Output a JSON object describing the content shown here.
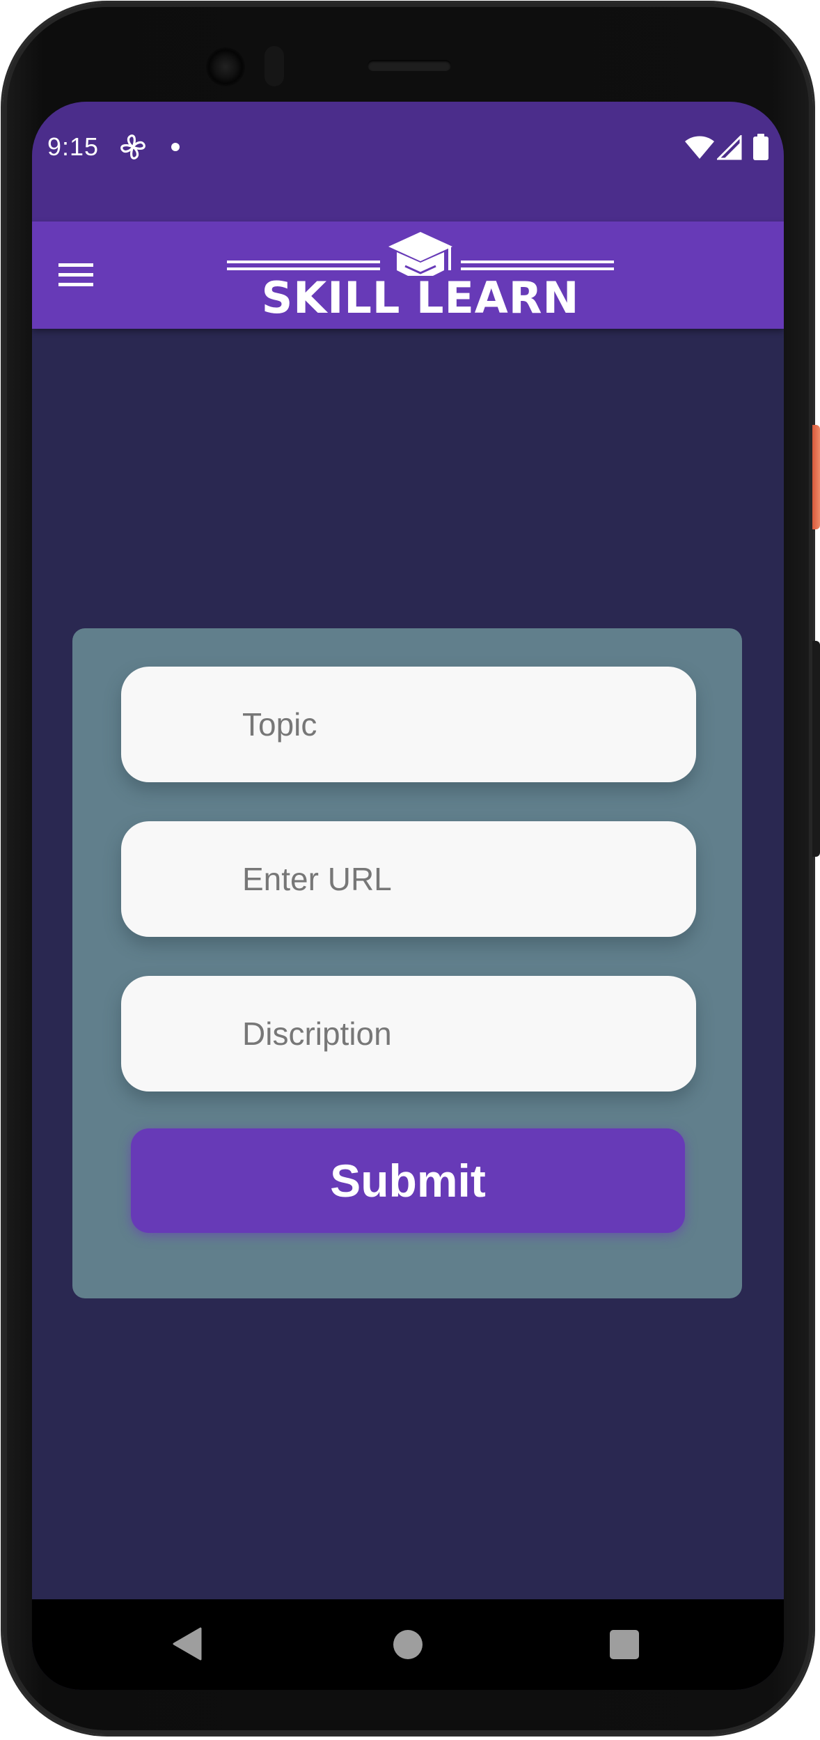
{
  "status_bar": {
    "time": "9:15",
    "icons": [
      "fan-icon",
      "notification-dot-icon",
      "wifi-icon",
      "cellular-signal-icon",
      "battery-icon"
    ]
  },
  "app_bar": {
    "menu_icon": "hamburger-menu-icon",
    "logo_text": "SKILL LEARN",
    "logo_icon": "graduation-cap-icon",
    "color": "#673ab7"
  },
  "form": {
    "topic_placeholder": "Topic",
    "url_placeholder": "Enter URL",
    "description_placeholder": "Discription",
    "submit_label": "Submit",
    "card_color": "#617f8c",
    "button_color": "#673ab7"
  },
  "nav_bar": {
    "icons": [
      "back-icon",
      "home-icon",
      "recents-icon"
    ]
  },
  "colors": {
    "background": "#2a2851",
    "status_bar": "#4b2d8b"
  }
}
